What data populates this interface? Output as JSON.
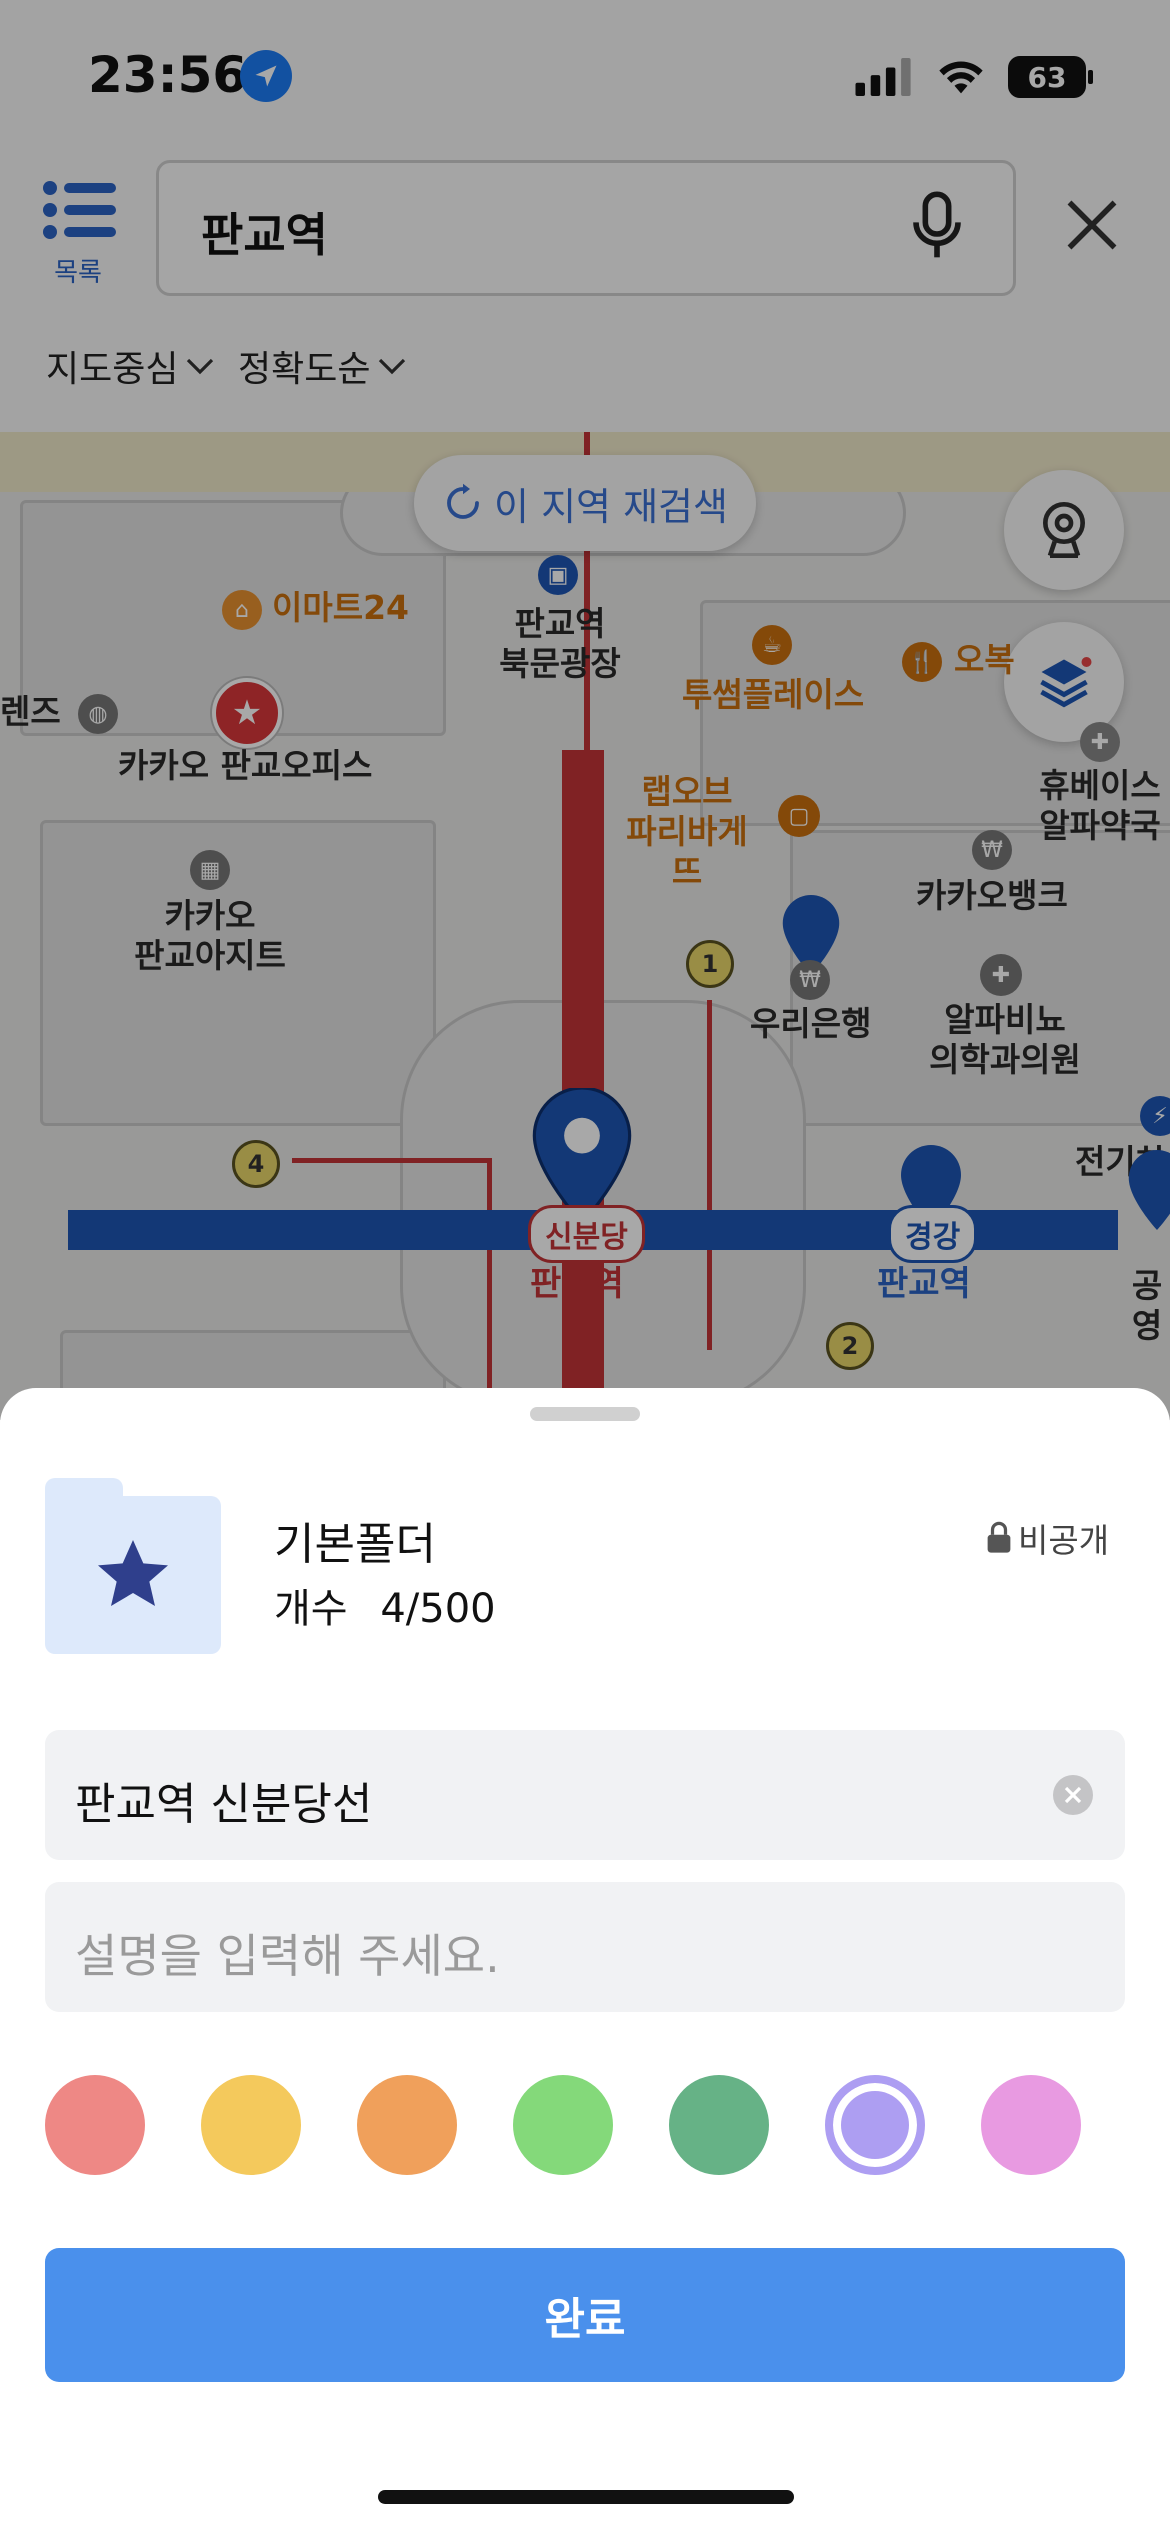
{
  "status_bar": {
    "time": "23:56",
    "battery": "63"
  },
  "search": {
    "list_label": "목록",
    "query": "판교역"
  },
  "filters": [
    {
      "label": "지도중심"
    },
    {
      "label": "정확도순"
    }
  ],
  "map": {
    "research_label": "이 지역 재검색",
    "places": {
      "emart24": "이마트24",
      "pangyo_north_1": "판교역",
      "pangyo_north_2": "북문광장",
      "twosome": "투썸플레이스",
      "obok": "오복",
      "rendz": "렌즈",
      "kakao_office": "카카오 판교오피스",
      "paris_1": "랩오브",
      "paris_2": "파리바게뜨",
      "hue_1": "휴베이스",
      "hue_2": "알파약국",
      "kakaobank": "카카오뱅크",
      "kakao_agit_1": "카카오",
      "kakao_agit_2": "판교아지트",
      "woori": "우리은행",
      "alpha_1": "알파비뇨",
      "alpha_2": "의학과의원",
      "jeongi": "전기차",
      "gongyeong": "공영"
    },
    "exits": [
      "1",
      "4",
      "2"
    ],
    "stations": {
      "sinbundang_line": "신분당",
      "sinbundang_name": "판교역",
      "gyeonggang_line": "경강",
      "gyeonggang_name": "판교역"
    }
  },
  "folder": {
    "name": "기본폴더",
    "count_label": "개수",
    "count": "4/500",
    "privacy": "비공개"
  },
  "form": {
    "title_value": "판교역 신분당선",
    "description_placeholder": "설명을 입력해 주세요."
  },
  "colors": {
    "options": [
      "#ee8885",
      "#f4c95c",
      "#f0a05b",
      "#84d97a",
      "#66b286",
      "#ad9ef2",
      "#e89ae1"
    ],
    "selected_index": 5,
    "accent": "#4a90ec"
  },
  "confirm_label": "완료"
}
